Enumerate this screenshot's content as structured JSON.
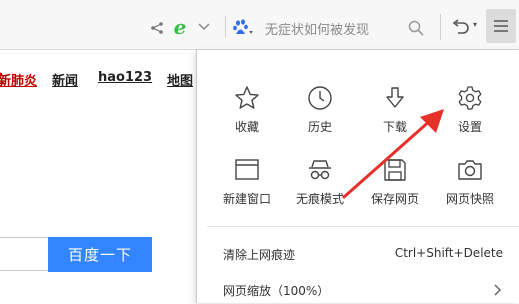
{
  "toolbar": {
    "search_placeholder": "无症状如何被发现",
    "undo_dropdown": "▾"
  },
  "page": {
    "links": [
      {
        "label": "新肺炎",
        "badge": "•"
      },
      {
        "label": "新闻"
      },
      {
        "label": "hao123"
      },
      {
        "label": "地图"
      }
    ],
    "search_button": "百度一下"
  },
  "menu": {
    "grid": [
      {
        "label": "收藏",
        "icon": "star-icon"
      },
      {
        "label": "历史",
        "icon": "clock-icon"
      },
      {
        "label": "下载",
        "icon": "download-icon"
      },
      {
        "label": "设置",
        "icon": "gear-icon"
      },
      {
        "label": "新建窗口",
        "icon": "window-icon"
      },
      {
        "label": "无痕模式",
        "icon": "incognito-icon"
      },
      {
        "label": "保存网页",
        "icon": "save-icon"
      },
      {
        "label": "网页快照",
        "icon": "camera-icon"
      }
    ],
    "rows": [
      {
        "label": "清除上网痕迹",
        "shortcut": "Ctrl+Shift+Delete"
      },
      {
        "label": "网页缩放（100%）",
        "has_submenu": true
      }
    ]
  },
  "colors": {
    "accent_blue": "#3385ff",
    "annotation_red": "#e8302a",
    "browser_green": "#3bbf4a"
  }
}
